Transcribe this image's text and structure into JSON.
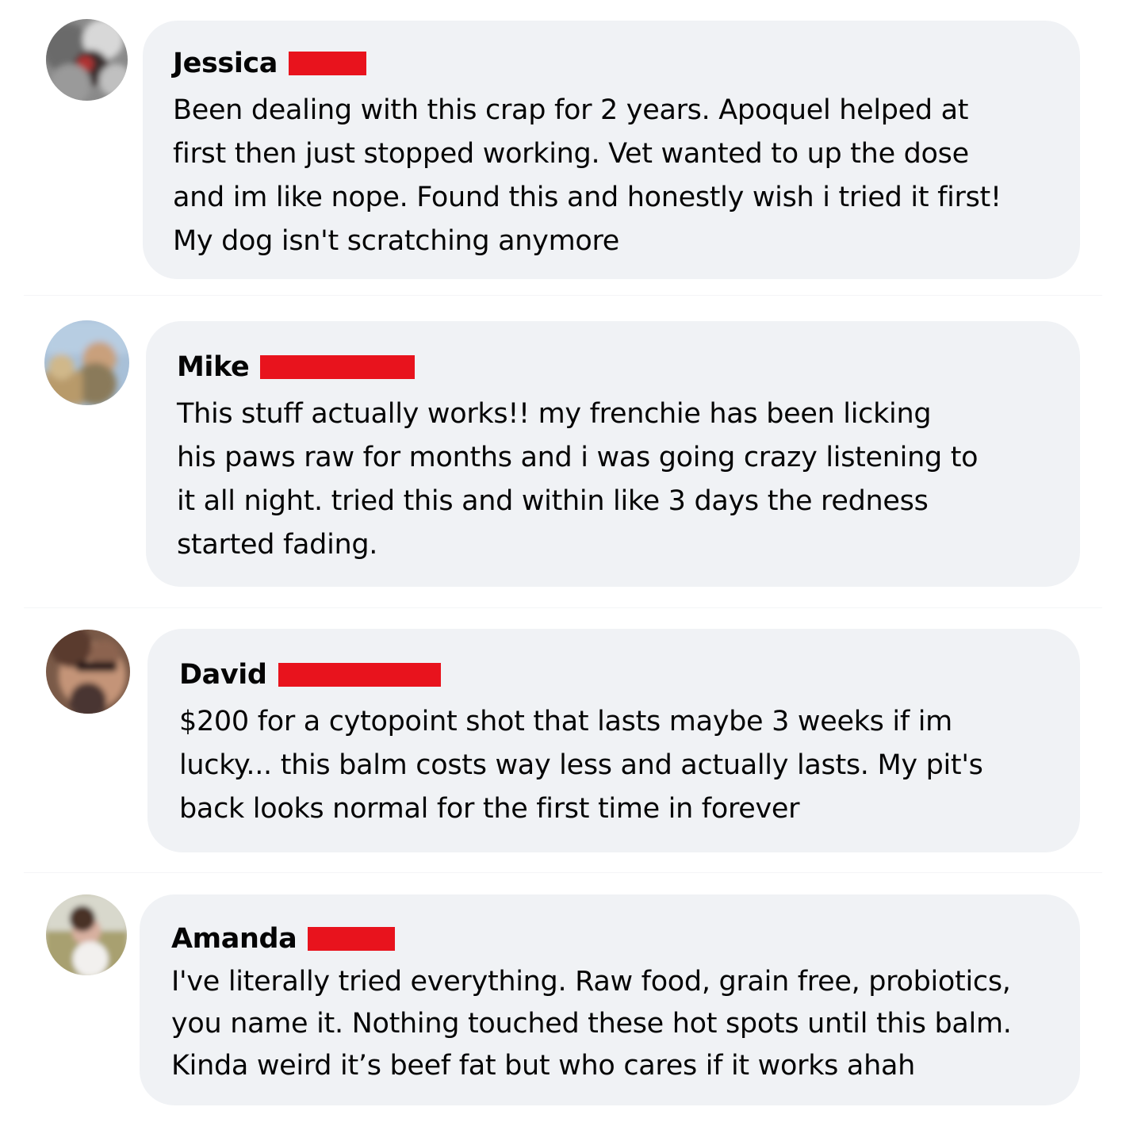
{
  "comments": [
    {
      "author": "Jessica",
      "lines": [
        "Been dealing with this crap for 2 years. Apoquel helped at",
        "first then just stopped working. Vet wanted to up the dose",
        "and im like nope. Found this and honestly wish i tried it first!",
        "My dog isn't scratching anymore"
      ]
    },
    {
      "author": "Mike",
      "lines": [
        "This stuff actually works!! my frenchie has been licking",
        "his paws raw for months and i was going crazy listening to",
        "it all night. tried this and within like 3 days the redness",
        "started fading."
      ]
    },
    {
      "author": "David",
      "lines": [
        "$200 for a cytopoint shot that lasts maybe 3 weeks if im",
        "lucky... this balm costs way less and actually lasts. My pit's",
        "back looks normal for the first time in forever"
      ]
    },
    {
      "author": "Amanda",
      "lines": [
        "I've literally tried everything. Raw food, grain free, probiotics,",
        "you name it. Nothing touched these hot spots until this balm.",
        "Kinda weird it’s beef fat but who cares if it works ahah"
      ]
    }
  ],
  "colors": {
    "bubble": "#f0f2f5",
    "redaction": "#e8131d",
    "text": "#050505"
  }
}
